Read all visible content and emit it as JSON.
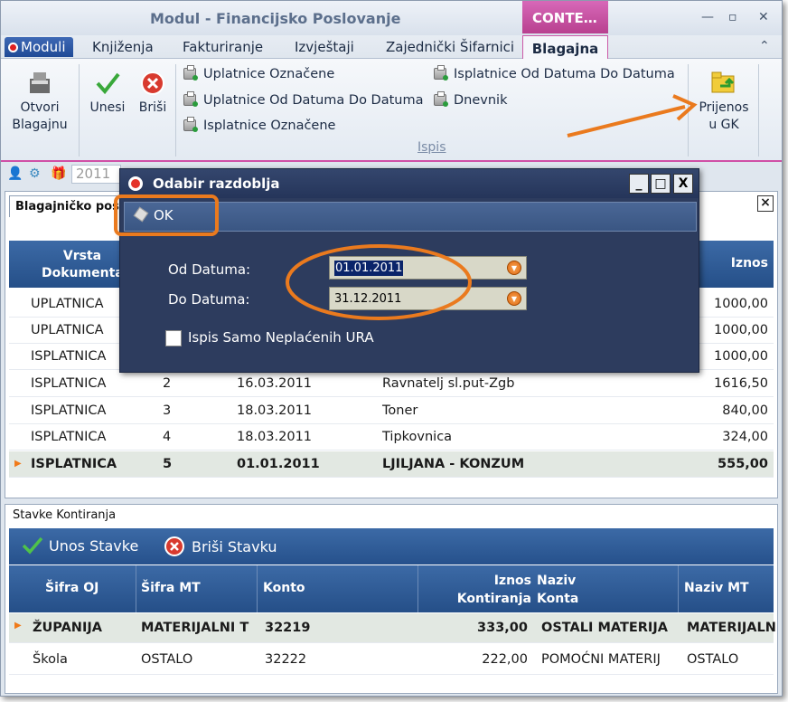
{
  "app": {
    "title": "Modul - Financijsko Poslovanje",
    "context_tab": "CONTE…"
  },
  "tabs": {
    "moduli": "Moduli",
    "items": [
      "Knjiženja",
      "Fakturiranje",
      "Izvještaji",
      "Zajednički Šifarnici"
    ],
    "active": "Blagajna"
  },
  "ribbon": {
    "otvori": "Otvori\nBlagajnu",
    "otvori_l1": "Otvori",
    "otvori_l2": "Blagajnu",
    "unesi": "Unesi",
    "brisi": "Briši",
    "print_items": [
      "Uplatnice Označene",
      "Uplatnice Od Datuma Do Datuma",
      "Isplatnice Označene",
      "Isplatnice Od Datuma Do Datuma",
      "Dnevnik"
    ],
    "group_label": "Ispis",
    "prijenos_l1": "Prijenos",
    "prijenos_l2": "u GK"
  },
  "status": {
    "year": "2011"
  },
  "document": {
    "tab_label": "Blagajničko pos",
    "headers": {
      "vrsta_l1": "Vrsta",
      "vrsta_l2": "Dokumenta",
      "iznos": "Iznos"
    },
    "rows": [
      {
        "vrsta": "UPLATNICA",
        "broj": "",
        "datum": "",
        "opis": "",
        "iznos": "1000,00"
      },
      {
        "vrsta": "UPLATNICA",
        "broj": "",
        "datum": "",
        "opis": "",
        "iznos": "1000,00"
      },
      {
        "vrsta": "ISPLATNICA",
        "broj": "",
        "datum": "",
        "opis": "",
        "iznos": "1000,00"
      },
      {
        "vrsta": "ISPLATNICA",
        "broj": "2",
        "datum": "16.03.2011",
        "opis": "Ravnatelj sl.put-Zgb",
        "iznos": "1616,50"
      },
      {
        "vrsta": "ISPLATNICA",
        "broj": "3",
        "datum": "18.03.2011",
        "opis": "Toner",
        "iznos": "840,00"
      },
      {
        "vrsta": "ISPLATNICA",
        "broj": "4",
        "datum": "18.03.2011",
        "opis": "Tipkovnica",
        "iznos": "324,00"
      },
      {
        "vrsta": "ISPLATNICA",
        "broj": "5",
        "datum": "01.01.2011",
        "opis": "LJILJANA - KONZUM",
        "iznos": "555,00"
      }
    ]
  },
  "stavke": {
    "label": "Stavke Kontiranja",
    "add": "Unos Stavke",
    "delete": "Briši Stavku",
    "headers": {
      "sifra_oj": "Šifra OJ",
      "sifra_mt": "Šifra MT",
      "konto": "Konto",
      "iznos_l1": "Iznos",
      "iznos_l2": "Kontiranja",
      "naziv_l1": "Naziv",
      "naziv_l2": "Konta",
      "naziv_mt": "Naziv MT"
    },
    "rows": [
      {
        "oj": "ŽUPANIJA",
        "mt": "MATERIJALNI T",
        "konto": "32219",
        "iznos": "333,00",
        "naziv": "OSTALI MATERIJA",
        "naziv_mt": "MATERIJALN"
      },
      {
        "oj": "Škola",
        "mt": "OSTALO",
        "konto": "32222",
        "iznos": "222,00",
        "naziv": "POMOĆNI MATERIJ",
        "naziv_mt": "OSTALO"
      }
    ]
  },
  "dialog": {
    "title": "Odabir razdoblja",
    "ok": "OK",
    "from_label": "Od Datuma:",
    "from_value": "01.01.2011",
    "to_label": "Do Datuma:",
    "to_value": "31.12.2011",
    "checkbox_label": "Ispis Samo Neplaćenih URA",
    "checkbox_checked": false,
    "minimize": "_",
    "maximize": "□",
    "close": "X"
  },
  "colors": {
    "accent": "#ea7a1e",
    "grid_header": "#2f5b96",
    "context": "#c24d9b"
  }
}
